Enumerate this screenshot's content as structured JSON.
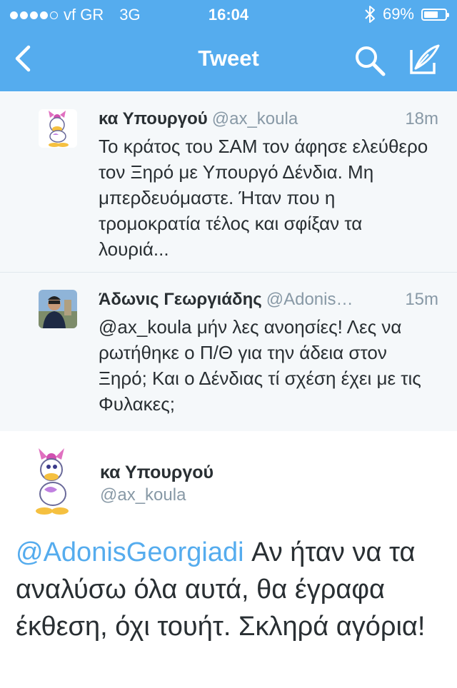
{
  "status_bar": {
    "carrier": "vf GR",
    "network": "3G",
    "time": "16:04",
    "battery": "69%",
    "battery_level": 0.69
  },
  "nav": {
    "title": "Tweet"
  },
  "colors": {
    "twitter_blue": "#55acee",
    "gray_text": "#8899a6"
  },
  "tweets": [
    {
      "name": "κα Υπουργού",
      "handle": "@ax_koula",
      "time": "18m",
      "text": "Το κράτος του ΣΑΜ τον άφησε ελεύθερο τον Ξηρό με Υπουργό Δένδια. Μη μπερδευόμαστε. Ήταν που η τρομοκρατία τέλος και σφίξαν τα λουριά..."
    },
    {
      "name": "Άδωνις Γεωργιάδης",
      "handle": "@Adonis…",
      "time": "15m",
      "text": "@ax_koula μήν λες ανοησίες! Λες να ρωτήθηκε ο Π/Θ για την άδεια στον Ξηρό; Και ο Δένδιας τί σχέση έχει με τις Φυλακες;"
    }
  ],
  "detail": {
    "name": "κα Υπουργού",
    "handle": "@ax_koula",
    "mention": "@AdonisGeorgiadi",
    "text": " Αν ήταν να τα αναλύσω όλα αυτά, θα έγραφα έκθεση, όχι τουήτ. Σκληρά αγόρια!"
  }
}
